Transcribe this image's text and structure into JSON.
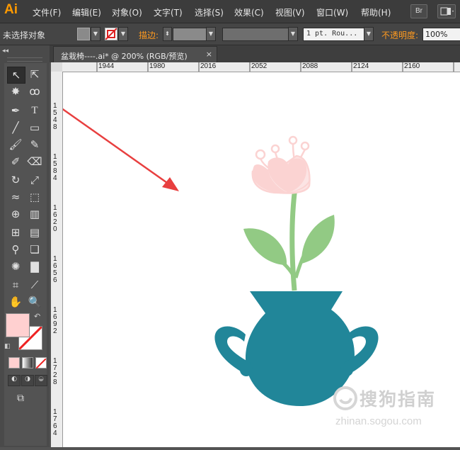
{
  "app": {
    "logo": "Ai"
  },
  "menu": [
    "文件(F)",
    "编辑(E)",
    "对象(O)",
    "文字(T)",
    "选择(S)",
    "效果(C)",
    "视图(V)",
    "窗口(W)",
    "帮助(H)"
  ],
  "menubar_right": {
    "bridge_label": "Br"
  },
  "control": {
    "selection_label": "未选择对象",
    "stroke_label": "描边:",
    "stroke_profile": "1 pt. Rou...",
    "opacity_label": "不透明度:",
    "opacity_value": "100%",
    "fill_color": "#ffd0d0"
  },
  "document_tab": {
    "title": "盆栽椅----.ai* @ 200% (RGB/预览)",
    "close": "×"
  },
  "ruler": {
    "horizontal": [
      "1944",
      "1980",
      "2016",
      "2052",
      "2088",
      "2124",
      "2160"
    ],
    "vertical": [
      "1548",
      "1584",
      "1620",
      "1656",
      "1692",
      "1728",
      "1764"
    ]
  },
  "colors": {
    "vase": "#218699",
    "leaf": "#92ca84",
    "flower": "#fbd3d2",
    "arrow": "#e83f3f"
  },
  "watermark": {
    "text": "搜狗指南",
    "url": "zhinan.sogou.com"
  }
}
